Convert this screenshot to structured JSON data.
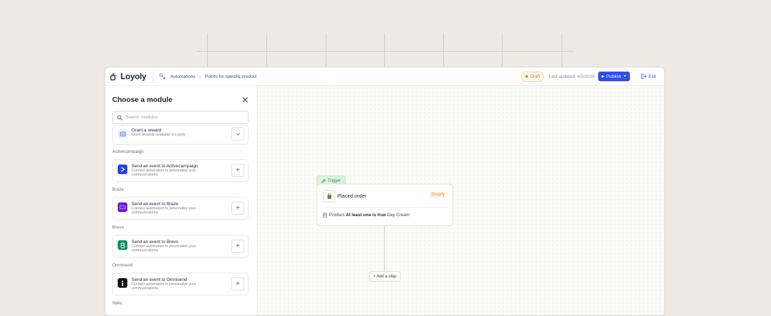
{
  "app": {
    "logo": "Loyoly",
    "breadcrumb": [
      "Automations",
      "Points for specifiq product"
    ],
    "breadcrumb_sep": "›",
    "status": "Draft",
    "last_updated": "Last updated: 4/3/2026",
    "publish_label": "Publish",
    "exit_label": "Exit"
  },
  "sidebar": {
    "title": "Choose a module",
    "search_placeholder": "Search modules",
    "reward": {
      "title": "Grant a reward",
      "desc": "Grant rewards available in Loyoly"
    },
    "sections": [
      {
        "name": "Activecampaign",
        "item_title": "Send an event to Activecampaign",
        "item_desc": "Connect automation to personalize your communications."
      },
      {
        "name": "Braze",
        "item_title": "Send an event to Braze",
        "item_desc": "Connect automation to personalize your communications."
      },
      {
        "name": "Brevo",
        "item_title": "Send an event to Brevo",
        "item_desc": "Connect automation to personalize your communications."
      },
      {
        "name": "Omnisend",
        "item_title": "Send an event to Omnisend",
        "item_desc": "Connect automation to personalize your communications."
      },
      {
        "name": "Splio"
      }
    ],
    "add_symbol": "+"
  },
  "canvas": {
    "trigger_label": "Trigger",
    "node_title": "Placed order",
    "node_badge": "Shopify",
    "condition": {
      "field": "Product",
      "operator": "At least one is true",
      "value": "Day Cream"
    },
    "add_step": "+ Add a step"
  },
  "icons": {
    "logo": "loyoly-logo-icon",
    "automations": "automation-icon",
    "close": "close-icon",
    "search": "search-icon",
    "reward": "gift-icon",
    "activecampaign": "activecampaign-logo-icon",
    "braze": "braze-logo-icon",
    "brevo": "brevo-logo-icon",
    "omnisend": "omnisend-logo-icon",
    "trigger": "pencil-icon",
    "shopify": "shopify-bag-icon",
    "condition": "document-icon"
  },
  "colors": {
    "accent": "#2f4ef0",
    "draft": "#e08a1e",
    "trigger_green": "#2b8a46",
    "activecampaign": "#2540e6",
    "braze": "#6a1fd0",
    "brevo": "#0b8f62",
    "omnisend": "#111111"
  }
}
